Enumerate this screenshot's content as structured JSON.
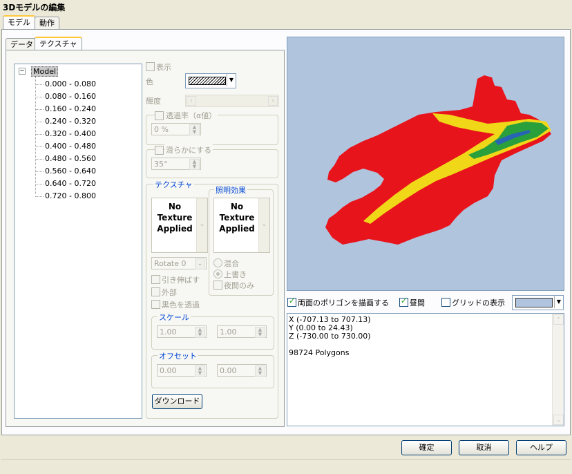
{
  "window": {
    "title": "3Dモデルの編集"
  },
  "main_tabs": [
    {
      "label": "モデル"
    },
    {
      "label": "動作"
    }
  ],
  "sub_tabs": [
    {
      "label": "データ"
    },
    {
      "label": "テクスチャ"
    }
  ],
  "tree": {
    "root": "Model",
    "items": [
      "0.000 - 0.080",
      "0.080 - 0.160",
      "0.160 - 0.240",
      "0.240 - 0.320",
      "0.320 - 0.400",
      "0.400 - 0.480",
      "0.480 - 0.560",
      "0.560 - 0.640",
      "0.640 - 0.720",
      "0.720 - 0.800"
    ]
  },
  "props": {
    "show_label": "表示",
    "color_label": "色",
    "brightness_label": "輝度",
    "transparency_label": "透過率（α値）",
    "transparency_value": "0 %",
    "smooth_label": "滑らかにする",
    "smooth_value": "35°",
    "texture_group": "テクスチャ",
    "lighting_group": "照明効果",
    "texture_text": [
      "No",
      "Texture",
      "Applied"
    ],
    "lighting_text": [
      "No",
      "Texture",
      "Applied"
    ],
    "rotate_value": "Rotate 0",
    "stretch_label": "引き伸ばす",
    "outer_label": "外部",
    "black_transparent_label": "黒色を透過",
    "mix_label": "混合",
    "overwrite_label": "上書き",
    "night_only_label": "夜間のみ",
    "scale_group": "スケール",
    "scale_x": "1.00",
    "scale_y": "1.00",
    "offset_group": "オフセット",
    "offset_x": "0.00",
    "offset_y": "0.00",
    "download_button": "ダウンロード"
  },
  "preview": {
    "background_color": "#b0c4de",
    "double_sided_label": "両面のポリゴンを描画する",
    "daytime_label": "昼間",
    "grid_label": "グリッドの表示",
    "grid_color": "#b0c4de"
  },
  "info": {
    "lines": [
      "X (-707.13 to 707.13)",
      "Y (0.00 to 24.43)",
      "Z (-730.00 to 730.00)",
      "",
      "98724 Polygons"
    ]
  },
  "footer": {
    "ok": "確定",
    "cancel": "取消",
    "help": "ヘルプ"
  },
  "colors": {
    "terrain_red": "#e8141c",
    "terrain_yellow": "#f0d818",
    "terrain_green": "#2aa03c",
    "terrain_blue": "#2864b4"
  }
}
